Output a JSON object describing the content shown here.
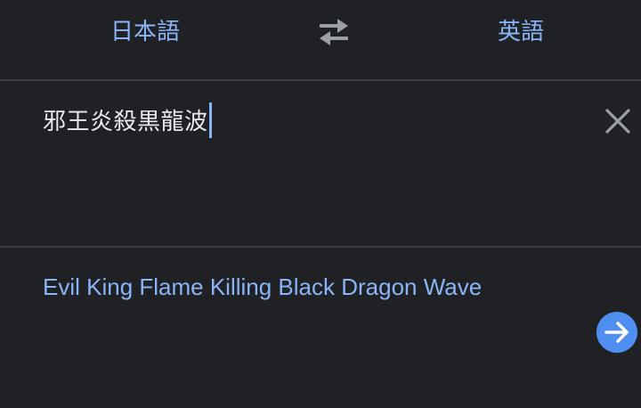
{
  "language_bar": {
    "source_language": "日本語",
    "target_language": "英語",
    "swap_icon": "swap-arrows-icon"
  },
  "input": {
    "text": "邪王炎殺黒龍波",
    "clear_icon": "close-icon"
  },
  "output": {
    "translation": "Evil King Flame Killing Black Dragon Wave",
    "go_icon": "arrow-right-icon"
  },
  "colors": {
    "background": "#202124",
    "accent": "#8ab4f8",
    "text": "#e8eaed",
    "divider": "#3c3d40",
    "go_button": "#4f8ff2"
  }
}
